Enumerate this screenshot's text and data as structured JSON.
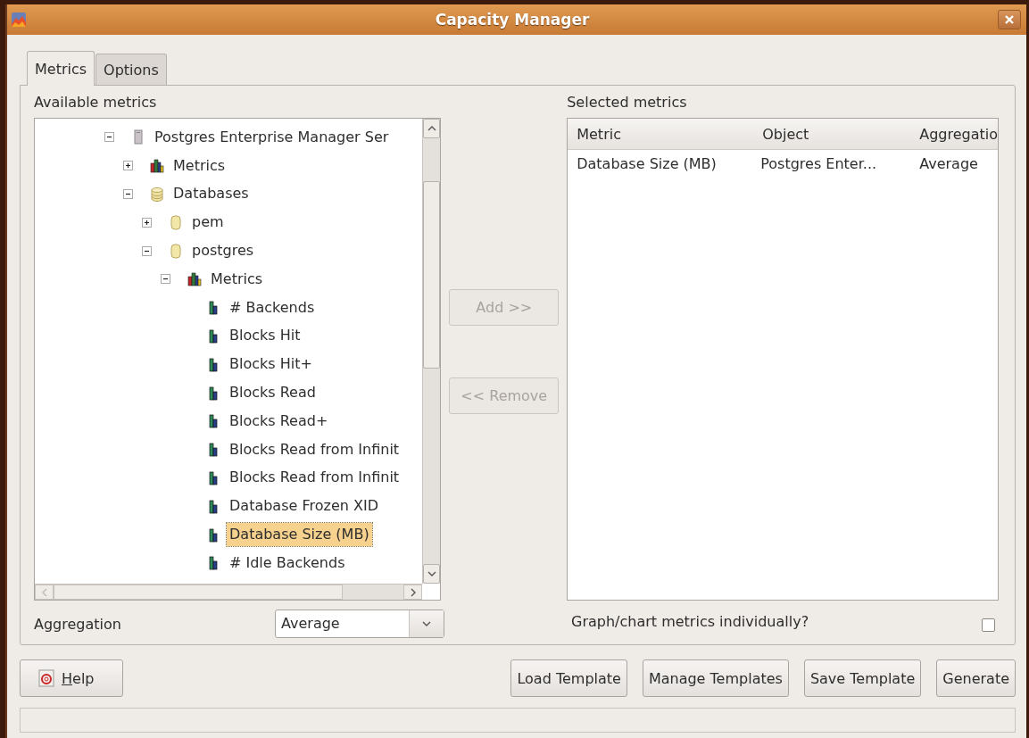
{
  "window": {
    "title": "Capacity Manager"
  },
  "tabs": [
    {
      "label": "Metrics",
      "selected": true
    },
    {
      "label": "Options",
      "selected": false
    }
  ],
  "available": {
    "label": "Available metrics",
    "tree": [
      {
        "label": "Postgres Enterprise Manager Ser",
        "kind": "server",
        "expanded": true,
        "selected": false,
        "children": [
          {
            "label": "Metrics",
            "kind": "metrics-group",
            "expanded": false,
            "selected": false
          },
          {
            "label": "Databases",
            "kind": "database-group",
            "expanded": true,
            "selected": false,
            "children": [
              {
                "label": "pem",
                "kind": "database",
                "expanded": false,
                "selected": false
              },
              {
                "label": "postgres",
                "kind": "database",
                "expanded": true,
                "selected": false,
                "children": [
                  {
                    "label": "Metrics",
                    "kind": "metrics-group",
                    "expanded": true,
                    "selected": false,
                    "children": [
                      {
                        "label": "# Backends",
                        "kind": "metric",
                        "selected": false
                      },
                      {
                        "label": "Blocks Hit",
                        "kind": "metric",
                        "selected": false
                      },
                      {
                        "label": "Blocks Hit+",
                        "kind": "metric",
                        "selected": false
                      },
                      {
                        "label": "Blocks Read",
                        "kind": "metric",
                        "selected": false
                      },
                      {
                        "label": "Blocks Read+",
                        "kind": "metric",
                        "selected": false
                      },
                      {
                        "label": "Blocks Read from Infinit",
                        "kind": "metric",
                        "selected": false
                      },
                      {
                        "label": "Blocks Read from Infinit",
                        "kind": "metric",
                        "selected": false
                      },
                      {
                        "label": "Database Frozen XID",
                        "kind": "metric",
                        "selected": false
                      },
                      {
                        "label": "Database Size (MB)",
                        "kind": "metric",
                        "selected": true
                      },
                      {
                        "label": "# Idle Backends",
                        "kind": "metric",
                        "selected": false
                      }
                    ]
                  }
                ]
              }
            ]
          }
        ]
      }
    ]
  },
  "transfer_buttons": [
    {
      "label": "Add >>",
      "disabled": true
    },
    {
      "label": "<< Remove",
      "disabled": true
    }
  ],
  "selected_metrics": {
    "label": "Selected metrics",
    "columns": [
      "Metric",
      "Object",
      "Aggregatio"
    ],
    "rows": [
      [
        "Database Size (MB)",
        "Postgres Enter...",
        "Average"
      ]
    ]
  },
  "aggregation": {
    "label": "Aggregation",
    "value": "Average"
  },
  "individually": {
    "label": "Graph/chart metrics individually?",
    "checked": false
  },
  "footer_buttons": [
    {
      "label": "Help",
      "kind": "help"
    },
    {
      "label": "Load Template",
      "kind": "action"
    },
    {
      "label": "Manage Templates",
      "kind": "action"
    },
    {
      "label": "Save Template",
      "kind": "action"
    },
    {
      "label": "Generate",
      "kind": "action"
    }
  ]
}
